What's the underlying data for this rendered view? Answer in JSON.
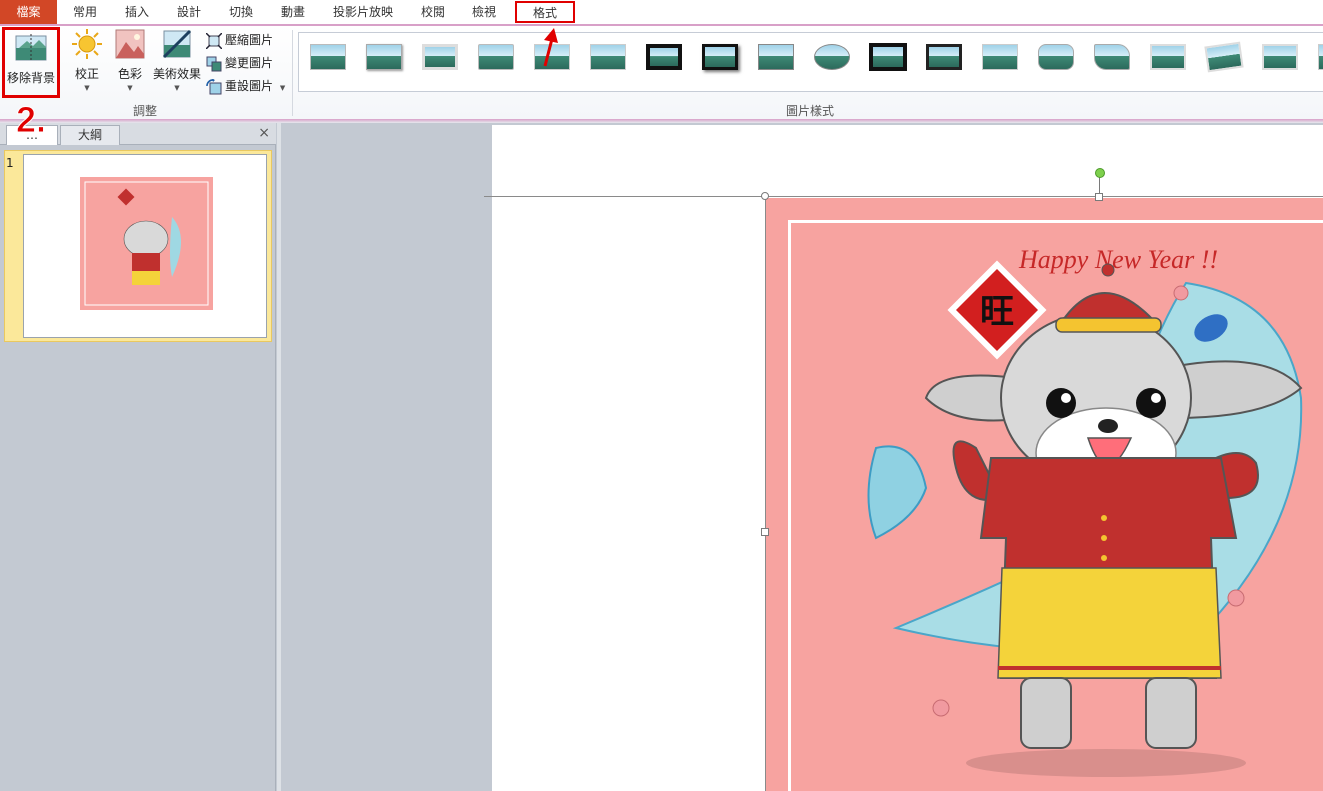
{
  "tabs": {
    "file": "檔案",
    "home": "常用",
    "insert": "插入",
    "design": "設計",
    "transitions": "切換",
    "animations": "動畫",
    "slideshow": "投影片放映",
    "review": "校閱",
    "view": "檢視",
    "format": "格式",
    "active": "format"
  },
  "ribbon": {
    "adjust_group": {
      "label": "調整",
      "remove_background": "移除背景",
      "corrections": "校正",
      "color": "色彩",
      "artistic_effects": "美術效果",
      "compress_pictures": "壓縮圖片",
      "change_picture": "變更圖片",
      "reset_picture": "重設圖片"
    },
    "styles_group": {
      "label": "圖片樣式"
    }
  },
  "slide_pane": {
    "tab_slides_partial": "…",
    "tab_outline": "大綱",
    "close": "×",
    "thumbnail_number": "1"
  },
  "annotation": {
    "step": "2."
  },
  "picture": {
    "caption": "Happy New Year !!",
    "badge_char": "旺"
  },
  "colors": {
    "file_tab": "#d24726",
    "highlight": "#e00000",
    "picture_background": "#f7a3a0"
  }
}
